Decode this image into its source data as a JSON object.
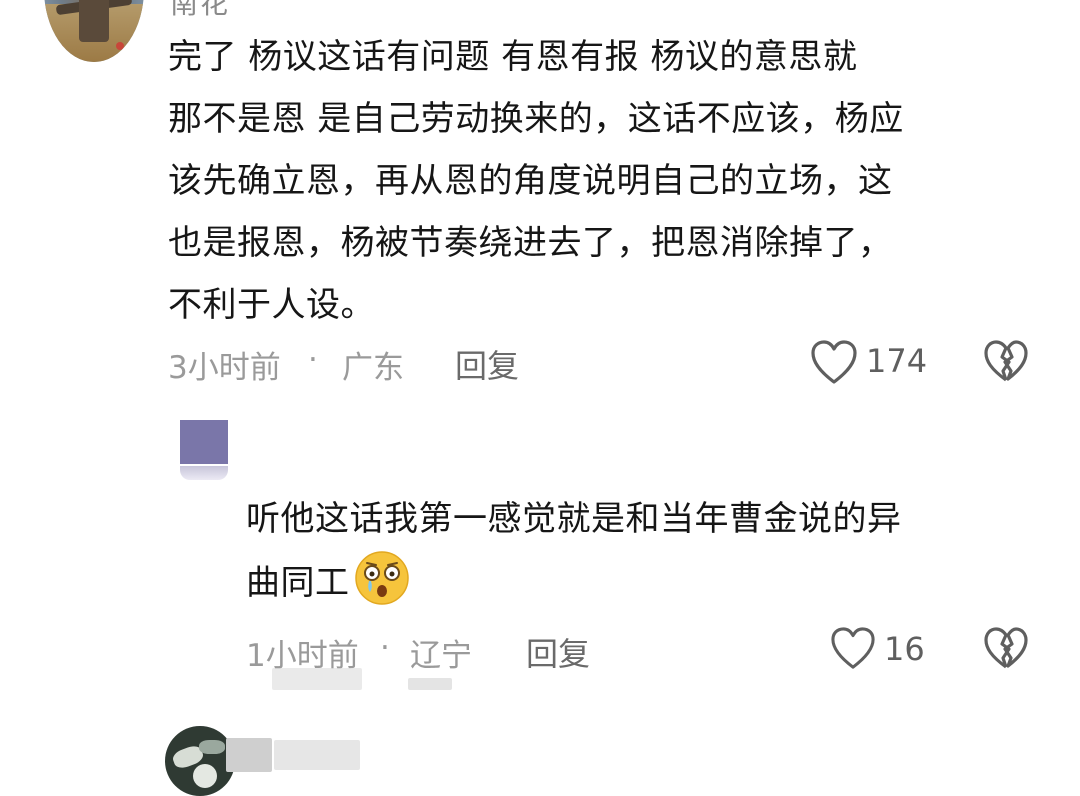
{
  "comment": {
    "username": "南花",
    "text": "完了  杨议这话有问题  有恩有报  杨议的意思就\n那不是恩  是自己劳动换来的，这话不应该，杨应\n该先确立恩，再从恩的角度说明自己的立场，这\n也是报恩，杨被节奏绕进去了，把恩消除掉了，\n不利于人设。",
    "time": "3小时前",
    "separator": "·",
    "location": "广东",
    "reply_label": "回复",
    "likes": "174",
    "like_icon": "heart-outline-icon",
    "dislike_icon": "broken-heart-icon"
  },
  "reply": {
    "text": "听他这话我第一感觉就是和当年曹金说的异\n曲同工",
    "emoji": "shocked-crying-emoji",
    "time": "1小时前",
    "separator": "·",
    "location": "辽宁",
    "reply_label": "回复",
    "likes": "16",
    "like_icon": "heart-outline-icon",
    "dislike_icon": "broken-heart-icon"
  },
  "colors": {
    "text": "#161616",
    "meta": "#9a9a9a",
    "icon": "#5f5f5f",
    "reply_avatar": "#7a76a9",
    "emoji_face": "#f6c43c"
  }
}
